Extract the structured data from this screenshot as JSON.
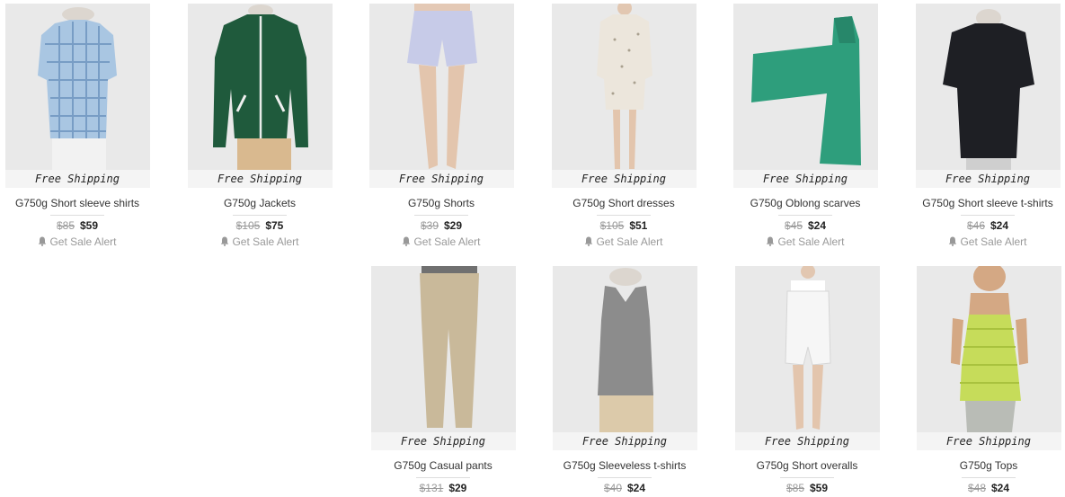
{
  "products": [
    {
      "free_shipping": "Free Shipping",
      "title": "G750g Short sleeve shirts",
      "orig_price": "$85",
      "sale_price": "$59",
      "alert_label": "Get Sale Alert"
    },
    {
      "free_shipping": "Free Shipping",
      "title": "G750g Jackets",
      "orig_price": "$105",
      "sale_price": "$75",
      "alert_label": "Get Sale Alert"
    },
    {
      "free_shipping": "Free Shipping",
      "title": "G750g Shorts",
      "orig_price": "$39",
      "sale_price": "$29",
      "alert_label": "Get Sale Alert"
    },
    {
      "free_shipping": "Free Shipping",
      "title": "G750g Short dresses",
      "orig_price": "$105",
      "sale_price": "$51",
      "alert_label": "Get Sale Alert"
    },
    {
      "free_shipping": "Free Shipping",
      "title": "G750g Oblong scarves",
      "orig_price": "$45",
      "sale_price": "$24",
      "alert_label": "Get Sale Alert"
    },
    {
      "free_shipping": "Free Shipping",
      "title": "G750g Short sleeve t-shirts",
      "orig_price": "$46",
      "sale_price": "$24",
      "alert_label": "Get Sale Alert"
    },
    {
      "free_shipping": "Free Shipping",
      "title": "G750g Casual pants",
      "orig_price": "$131",
      "sale_price": "$29"
    },
    {
      "free_shipping": "Free Shipping",
      "title": "G750g Sleeveless t-shirts",
      "orig_price": "$40",
      "sale_price": "$24"
    },
    {
      "free_shipping": "Free Shipping",
      "title": "G750g Short overalls",
      "orig_price": "$85",
      "sale_price": "$59"
    },
    {
      "free_shipping": "Free Shipping",
      "title": "G750g Tops",
      "orig_price": "$48",
      "sale_price": "$24"
    }
  ]
}
